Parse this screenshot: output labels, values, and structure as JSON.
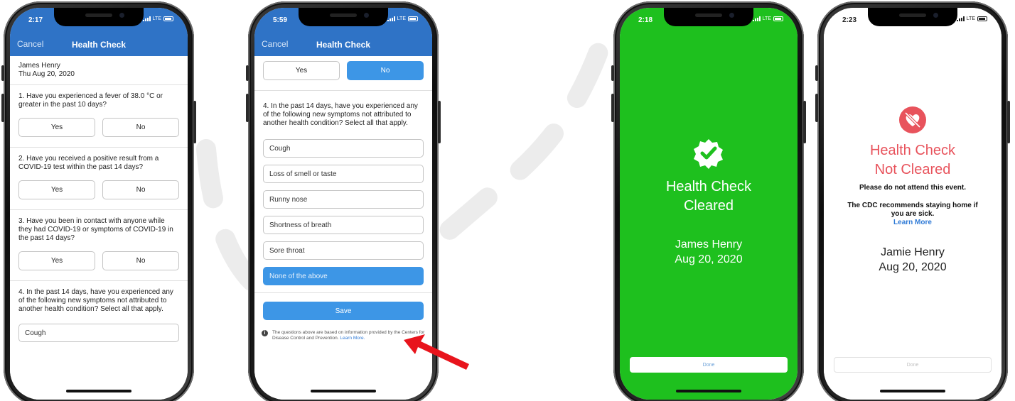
{
  "colors": {
    "nav_blue": "#2f73c6",
    "accent_blue": "#3d96e6",
    "cleared_green": "#1ec01e",
    "not_cleared_red": "#e8535c",
    "arrow_red": "#e8141c"
  },
  "phone1": {
    "status_time": "2:17",
    "network": "LTE",
    "nav": {
      "cancel": "Cancel",
      "title": "Health Check"
    },
    "header": {
      "name": "James Henry",
      "date": "Thu Aug 20, 2020"
    },
    "questions": [
      {
        "text": "1. Have you experienced a fever of 38.0 °C or greater in the past 10 days?",
        "yes": "Yes",
        "no": "No"
      },
      {
        "text": "2. Have you received a positive result from a COVID-19 test within the past 14 days?",
        "yes": "Yes",
        "no": "No"
      },
      {
        "text": "3. Have you been in contact with anyone while they had COVID-19 or symptoms of COVID-19 in the past 14 days?",
        "yes": "Yes",
        "no": "No"
      }
    ],
    "q4": {
      "text": "4. In the past 14 days, have you experienced any of the following new symptoms not attributed to another health condition? Select all that apply.",
      "first_option": "Cough"
    }
  },
  "phone2": {
    "status_time": "5:59",
    "network": "LTE",
    "nav": {
      "cancel": "Cancel",
      "title": "Health Check"
    },
    "prev_answer": {
      "yes": "Yes",
      "no": "No",
      "selected": "No"
    },
    "q4": {
      "text": "4. In the past 14 days, have you experienced any of the following new symptoms not attributed to another health condition? Select all that apply.",
      "options": [
        "Cough",
        "Loss of smell or taste",
        "Runny nose",
        "Shortness of breath",
        "Sore throat",
        "None of the above"
      ],
      "selected": "None of the above"
    },
    "save": "Save",
    "footnote": "The questions above are based on information provided by the Centers for Disease Control and Prevention.",
    "footnote_link": "Learn More."
  },
  "phone3": {
    "status_time": "2:18",
    "network": "LTE",
    "status_line1": "Health Check",
    "status_line2": "Cleared",
    "name": "James Henry",
    "date": "Aug 20, 2020",
    "done": "Done",
    "icon": "check-badge-icon"
  },
  "phone4": {
    "status_time": "2:23",
    "network": "LTE",
    "status_line1": "Health Check",
    "status_line2": "Not Cleared",
    "warning": "Please do not attend this event.",
    "cdc_text": "The CDC recommends staying home if you are sick.",
    "learn_more": "Learn More",
    "name": "Jamie Henry",
    "date": "Aug 20, 2020",
    "done": "Done",
    "icon": "crossed-heart-icon"
  }
}
